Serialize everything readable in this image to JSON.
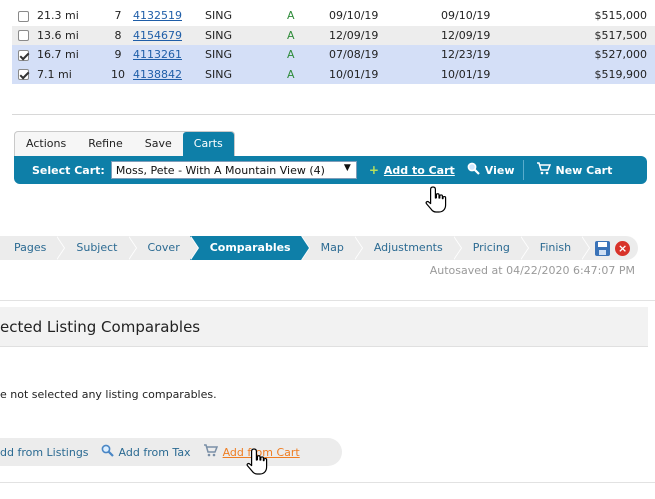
{
  "listings": {
    "rows": [
      {
        "checked": false,
        "distance": "21.3 mi",
        "num": "7",
        "mls": "4132519",
        "type": "SING",
        "status": "A",
        "date1": "09/10/19",
        "date2": "09/10/19",
        "price": "$515,000",
        "style": "odd"
      },
      {
        "checked": false,
        "distance": "13.6 mi",
        "num": "8",
        "mls": "4154679",
        "type": "SING",
        "status": "A",
        "date1": "12/09/19",
        "date2": "12/09/19",
        "price": "$517,500",
        "style": "even"
      },
      {
        "checked": true,
        "distance": "16.7 mi",
        "num": "9",
        "mls": "4113261",
        "type": "SING",
        "status": "A",
        "date1": "07/08/19",
        "date2": "12/23/19",
        "price": "$527,000",
        "style": "sel"
      },
      {
        "checked": true,
        "distance": "7.1 mi",
        "num": "10",
        "mls": "4138842",
        "type": "SING",
        "status": "A",
        "date1": "10/01/19",
        "date2": "10/01/19",
        "price": "$519,900",
        "style": "sel"
      }
    ]
  },
  "cart_tabs": [
    "Actions",
    "Refine",
    "Save",
    "Carts"
  ],
  "cart_tabs_active": "Carts",
  "cart_bar": {
    "label": "Select Cart:",
    "selected_cart": "Moss, Pete - With A Mountain View (4)",
    "add_to_cart": "Add to Cart",
    "view": "View",
    "new_cart": "New Cart"
  },
  "steps": [
    "Pages",
    "Subject",
    "Cover",
    "Comparables",
    "Map",
    "Adjustments",
    "Pricing",
    "Finish"
  ],
  "steps_active": "Comparables",
  "autosaved": "Autosaved at 04/22/2020 6:47:07 PM",
  "section": {
    "title": "ected Listing Comparables",
    "empty_message": "e not selected any listing comparables."
  },
  "add_bar": {
    "from_listings": "dd from Listings",
    "from_tax": "Add from Tax",
    "from_cart": "Add from Cart"
  },
  "colors": {
    "accent": "#0e7fa8",
    "link": "#1f5ea8",
    "status_active": "#2e8b3a",
    "hover_orange": "#ef7d22"
  }
}
